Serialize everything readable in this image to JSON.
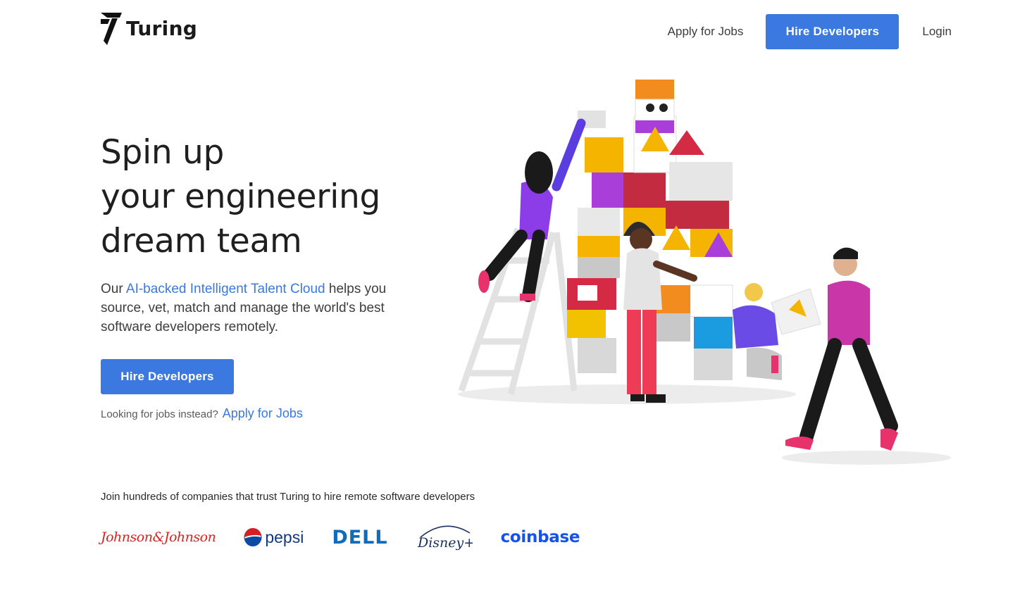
{
  "header": {
    "logo_text": "Turing",
    "nav": {
      "apply_label": "Apply for Jobs",
      "hire_label": "Hire Developers",
      "login_label": "Login"
    }
  },
  "hero": {
    "title_lines": [
      "Spin up",
      "your engineering",
      "dream team"
    ],
    "desc_prefix": "Our ",
    "desc_highlight": "AI-backed Intelligent Talent Cloud",
    "desc_suffix": " helps you source, vet, match and manage the world's best software developers remotely.",
    "cta_label": "Hire Developers",
    "jobs_prompt": "Looking for jobs instead?",
    "jobs_link": "Apply for Jobs"
  },
  "trust": {
    "text": "Join hundreds of companies that trust Turing to hire remote software developers",
    "logos": {
      "jj": "Johnson&Johnson",
      "pepsi": "pepsi",
      "dell": "DELL",
      "disney": "Disney+",
      "coinbase": "coinbase"
    }
  },
  "colors": {
    "accent": "#3b78e0",
    "text_dark": "#1f1f1f",
    "text_body": "#3d3d3d"
  }
}
